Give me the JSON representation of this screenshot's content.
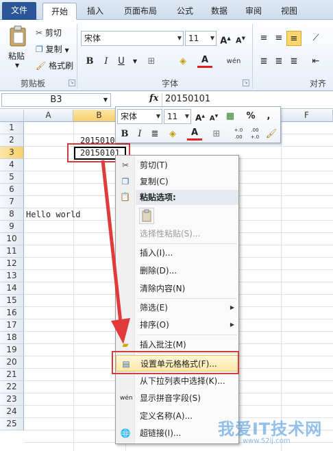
{
  "tabs": [
    {
      "label": "文件"
    },
    {
      "label": "开始"
    },
    {
      "label": "插入"
    },
    {
      "label": "页面布局"
    },
    {
      "label": "公式"
    },
    {
      "label": "数据"
    },
    {
      "label": "审阅"
    },
    {
      "label": "视图"
    }
  ],
  "clipboard": {
    "paste": "粘贴",
    "cut": "剪切",
    "copy": "复制",
    "format_painter": "格式刷",
    "group": "剪贴板"
  },
  "font": {
    "name": "宋体",
    "size": "11",
    "group": "字体",
    "bold": "B",
    "italic": "I",
    "underline": "U",
    "color_a": "A",
    "phonetic": "wén"
  },
  "align": {
    "group": "对齐方"
  },
  "formula_bar": {
    "name_box": "B3",
    "fx": "fx",
    "value": "20150101"
  },
  "columns": [
    "A",
    "B",
    "F"
  ],
  "rows": [
    "1",
    "2",
    "3",
    "4",
    "5",
    "6",
    "7",
    "8",
    "9",
    "10",
    "11",
    "12",
    "13",
    "14",
    "15",
    "16",
    "17",
    "18",
    "19",
    "20",
    "21",
    "22",
    "23",
    "24",
    "25"
  ],
  "cells": {
    "b2": "2015010",
    "b3": "20150101",
    "a8": "Hello world"
  },
  "mini_toolbar": {
    "font": "宋体",
    "size": "11",
    "percent": "%",
    "comma": ",",
    "bold": "B",
    "italic": "I",
    "dec_inc": "+.0 .00",
    "dec_dec": ".00 +.0"
  },
  "menu": {
    "cut": "剪切(T)",
    "copy": "复制(C)",
    "paste_options": "粘贴选项:",
    "paste_special": "选择性粘贴(S)...",
    "insert": "插入(I)...",
    "delete": "删除(D)...",
    "clear": "清除内容(N)",
    "filter": "筛选(E)",
    "sort": "排序(O)",
    "comment": "插入批注(M)",
    "format_cells": "设置单元格格式(F)...",
    "pick_list": "从下拉列表中选择(K)...",
    "phonetic": "显示拼音字段(S)",
    "define_name": "定义名称(A)...",
    "hyperlink": "超链接(I)..."
  },
  "watermark": {
    "text": "我爱IT技术网",
    "url": "www.52ij.com"
  },
  "colors": {
    "accent": "#2a5699",
    "highlight": "#ffe9a6",
    "annotation": "#d43a3a"
  }
}
